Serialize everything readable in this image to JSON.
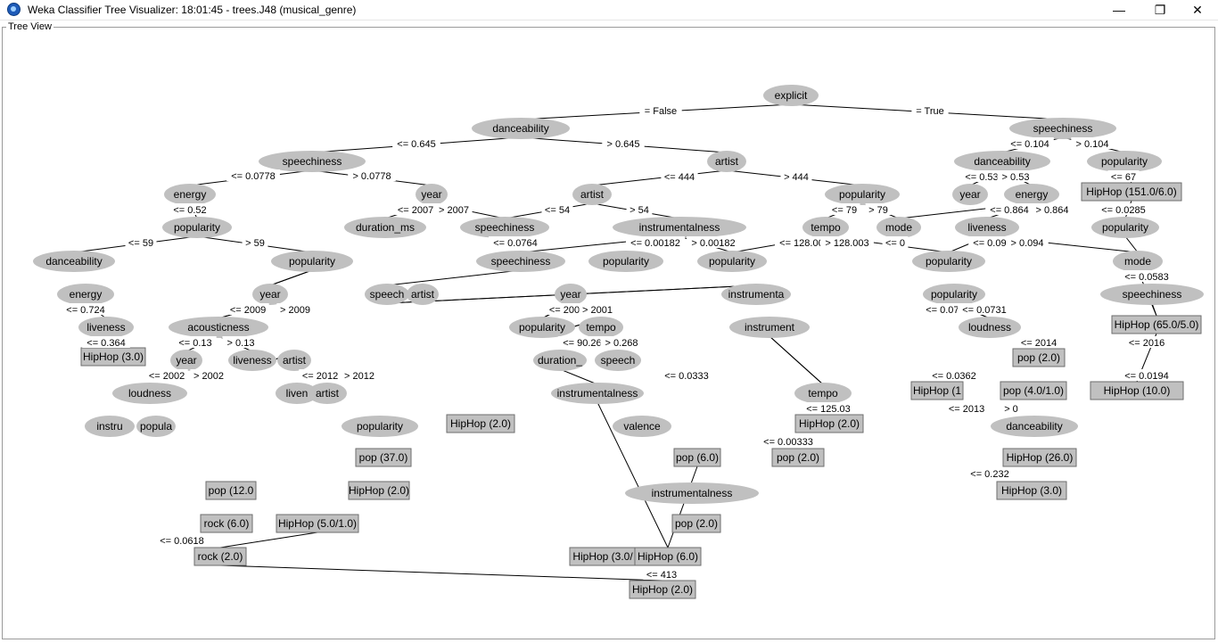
{
  "window": {
    "title": "Weka Classifier Tree Visualizer: 18:01:45 - trees.J48 (musical_genre)",
    "minimize_glyph": "—",
    "maximize_glyph": "❐",
    "close_glyph": "✕"
  },
  "panel": {
    "label": "Tree View"
  },
  "tree": {
    "nodes": [
      {
        "id": "explicit",
        "label": "explicit",
        "shape": "oval"
      },
      {
        "id": "danceability-1",
        "label": "danceability",
        "shape": "oval"
      },
      {
        "id": "speechiness-r",
        "label": "speechiness",
        "shape": "oval"
      },
      {
        "id": "speechiness-2",
        "label": "speechiness",
        "shape": "oval"
      },
      {
        "id": "artist-2",
        "label": "artist",
        "shape": "oval"
      },
      {
        "id": "danceability-r",
        "label": "danceability",
        "shape": "oval"
      },
      {
        "id": "popularity-r",
        "label": "popularity",
        "shape": "oval"
      },
      {
        "id": "energy-3",
        "label": "energy",
        "shape": "oval"
      },
      {
        "id": "year-3",
        "label": "year",
        "shape": "oval"
      },
      {
        "id": "artist-3",
        "label": "artist",
        "shape": "oval"
      },
      {
        "id": "popularity-3",
        "label": "popularity",
        "shape": "oval"
      },
      {
        "id": "year-r3",
        "label": "year",
        "shape": "oval"
      },
      {
        "id": "energy-r3",
        "label": "energy",
        "shape": "oval"
      },
      {
        "id": "hiphop-151",
        "label": "HipHop (151.0/6.0)",
        "shape": "box"
      },
      {
        "id": "popularity-4",
        "label": "popularity",
        "shape": "oval"
      },
      {
        "id": "duration-4",
        "label": "duration_ms",
        "shape": "oval"
      },
      {
        "id": "speechiness-4",
        "label": "speechiness",
        "shape": "oval"
      },
      {
        "id": "instrumentalness-4",
        "label": "instrumentalness",
        "shape": "oval"
      },
      {
        "id": "tempo-4",
        "label": "tempo",
        "shape": "oval"
      },
      {
        "id": "mode-4",
        "label": "mode",
        "shape": "oval"
      },
      {
        "id": "liveness-r4",
        "label": "liveness",
        "shape": "oval"
      },
      {
        "id": "popularity-r4",
        "label": "popularity",
        "shape": "oval"
      },
      {
        "id": "danceability-5",
        "label": "danceability",
        "shape": "oval"
      },
      {
        "id": "popularity-5",
        "label": "popularity",
        "shape": "oval"
      },
      {
        "id": "speechiness-5",
        "label": "speechiness",
        "shape": "oval"
      },
      {
        "id": "popularity-5b",
        "label": "popularity",
        "shape": "oval"
      },
      {
        "id": "popularity-5c",
        "label": "popularity",
        "shape": "oval"
      },
      {
        "id": "popularity-5d",
        "label": "popularity",
        "shape": "oval"
      },
      {
        "id": "mode-5",
        "label": "mode",
        "shape": "oval"
      },
      {
        "id": "energy-6",
        "label": "energy",
        "shape": "oval"
      },
      {
        "id": "year-6",
        "label": "year",
        "shape": "oval"
      },
      {
        "id": "speech-6",
        "label": "speech",
        "shape": "oval"
      },
      {
        "id": "artist-6",
        "label": "artist",
        "shape": "oval"
      },
      {
        "id": "year-6b",
        "label": "year",
        "shape": "oval"
      },
      {
        "id": "instrumenta-6",
        "label": "instrumenta",
        "shape": "oval"
      },
      {
        "id": "popularity-6",
        "label": "popularity",
        "shape": "oval"
      },
      {
        "id": "speechiness-6",
        "label": "speechiness",
        "shape": "oval"
      },
      {
        "id": "liveness-7",
        "label": "liveness",
        "shape": "oval"
      },
      {
        "id": "acousticness-7",
        "label": "acousticness",
        "shape": "oval"
      },
      {
        "id": "popularity-7",
        "label": "popularity",
        "shape": "oval"
      },
      {
        "id": "tempo-7",
        "label": "tempo",
        "shape": "oval"
      },
      {
        "id": "instrument-7",
        "label": "instrument",
        "shape": "oval"
      },
      {
        "id": "loudness-7",
        "label": "loudness",
        "shape": "oval"
      },
      {
        "id": "hiphop-65",
        "label": "HipHop (65.0/5.0)",
        "shape": "box"
      },
      {
        "id": "hiphop-3a",
        "label": "HipHop (3.0)",
        "shape": "box"
      },
      {
        "id": "year-8",
        "label": "year",
        "shape": "oval"
      },
      {
        "id": "liveness-8",
        "label": "liveness",
        "shape": "oval"
      },
      {
        "id": "artist-8",
        "label": "artist",
        "shape": "oval"
      },
      {
        "id": "duration-8",
        "label": "duration_",
        "shape": "oval"
      },
      {
        "id": "speech-8",
        "label": "speech",
        "shape": "oval"
      },
      {
        "id": "pop-2-8",
        "label": "pop (2.0)",
        "shape": "box"
      },
      {
        "id": "loudness-9",
        "label": "loudness",
        "shape": "oval"
      },
      {
        "id": "liven-9",
        "label": "liven",
        "shape": "oval"
      },
      {
        "id": "artist-9",
        "label": "artist",
        "shape": "oval"
      },
      {
        "id": "instrumentalness-9",
        "label": "instrumentalness",
        "shape": "oval"
      },
      {
        "id": "tempo-9",
        "label": "tempo",
        "shape": "oval"
      },
      {
        "id": "hiphop-1-9",
        "label": "HipHop (1",
        "shape": "box"
      },
      {
        "id": "pop-4-9",
        "label": "pop (4.0/1.0)",
        "shape": "box"
      },
      {
        "id": "hiphop-10",
        "label": "HipHop (10.0)",
        "shape": "box"
      },
      {
        "id": "instru-10",
        "label": "instru",
        "shape": "oval"
      },
      {
        "id": "popula-10",
        "label": "popula",
        "shape": "oval"
      },
      {
        "id": "popularity-10",
        "label": "popularity",
        "shape": "oval"
      },
      {
        "id": "hiphop-2a",
        "label": "HipHop (2.0)",
        "shape": "box"
      },
      {
        "id": "valence-10",
        "label": "valence",
        "shape": "oval"
      },
      {
        "id": "hiphop-2b",
        "label": "HipHop (2.0)",
        "shape": "box"
      },
      {
        "id": "danceability-10",
        "label": "danceability",
        "shape": "oval"
      },
      {
        "id": "pop-37",
        "label": "pop (37.0)",
        "shape": "box"
      },
      {
        "id": "pop-6-11",
        "label": "pop (6.0)",
        "shape": "box"
      },
      {
        "id": "pop-2-11",
        "label": "pop (2.0)",
        "shape": "box"
      },
      {
        "id": "hiphop-26",
        "label": "HipHop (26.0)",
        "shape": "box"
      },
      {
        "id": "pop-12",
        "label": "pop (12.0",
        "shape": "box"
      },
      {
        "id": "hiphop-2c",
        "label": "HipHop (2.0)",
        "shape": "box"
      },
      {
        "id": "instrumentalness-12",
        "label": "instrumentalness",
        "shape": "oval"
      },
      {
        "id": "hiphop-3b",
        "label": "HipHop (3.0)",
        "shape": "box"
      },
      {
        "id": "rock-6",
        "label": "rock (6.0)",
        "shape": "box"
      },
      {
        "id": "hiphop-5",
        "label": "HipHop (5.0/1.0)",
        "shape": "box"
      },
      {
        "id": "pop-2-13",
        "label": "pop (2.0)",
        "shape": "box"
      },
      {
        "id": "rock-2",
        "label": "rock (2.0)",
        "shape": "box"
      },
      {
        "id": "hiphop-3c",
        "label": "HipHop (3.0/",
        "shape": "box"
      },
      {
        "id": "hiphop-6",
        "label": "HipHop (6.0)",
        "shape": "box"
      },
      {
        "id": "hiphop-2d",
        "label": "HipHop (2.0)",
        "shape": "box"
      }
    ],
    "edges": [
      {
        "label": "= False"
      },
      {
        "label": "= True"
      },
      {
        "label": "<= 0.645"
      },
      {
        "label": "> 0.645"
      },
      {
        "label": "<= 0.104"
      },
      {
        "label": "> 0.104"
      },
      {
        "label": "<= 0.0778"
      },
      {
        "label": "> 0.0778"
      },
      {
        "label": "<= 444"
      },
      {
        "label": "> 444"
      },
      {
        "label": "<= 0.53"
      },
      {
        "label": "> 0.53"
      },
      {
        "label": "<= 0.52"
      },
      {
        "label": "<= 2007"
      },
      {
        "label": "> 2007"
      },
      {
        "label": "<= 54"
      },
      {
        "label": "> 54"
      },
      {
        "label": "<= 79"
      },
      {
        "label": "> 79"
      },
      {
        "label": "<= 0.864"
      },
      {
        "label": "> 0.864"
      },
      {
        "label": "<= 59"
      },
      {
        "label": "> 59"
      },
      {
        "label": "<= 0.00182"
      },
      {
        "label": "> 0.00182"
      },
      {
        "label": "<= 128.003"
      },
      {
        "label": "> 128.003"
      },
      {
        "label": "<= 0.094"
      },
      {
        "label": "> 0.094"
      },
      {
        "label": "<= 2009"
      },
      {
        "label": "> 2009"
      },
      {
        "label": "<= 0.13"
      },
      {
        "label": "> 0.13"
      },
      {
        "label": "<= 2002"
      },
      {
        "label": "> 2002"
      },
      {
        "label": "<= 2012"
      },
      {
        "label": "> 2012"
      },
      {
        "label": "<= 2001"
      },
      {
        "label": "> 2001"
      },
      {
        "label": "<= 0.0764"
      },
      {
        "label": "<= 90.269"
      },
      {
        "label": "> 0.268"
      },
      {
        "label": "<= 2013"
      },
      {
        "label": "> 0"
      },
      {
        "label": "<= 2014"
      },
      {
        "label": "<= 125.03"
      },
      {
        "label": "<= 413"
      },
      {
        "label": "<= 0.0618"
      },
      {
        "label": "<= 0.724"
      },
      {
        "label": "<= 0.364"
      },
      {
        "label": "<= 0.0285"
      },
      {
        "label": "<= 67"
      },
      {
        "label": "<= 0.0583"
      },
      {
        "label": "<= 2016"
      },
      {
        "label": "<= 0"
      },
      {
        "label": "<= 0.0731"
      },
      {
        "label": "<= 0.0731"
      },
      {
        "label": "<= 0.0194"
      },
      {
        "label": "<= 0.00333"
      },
      {
        "label": "<= 0.0362"
      },
      {
        "label": "<= 0.232"
      },
      {
        "label": "<= 0.0333"
      }
    ]
  }
}
